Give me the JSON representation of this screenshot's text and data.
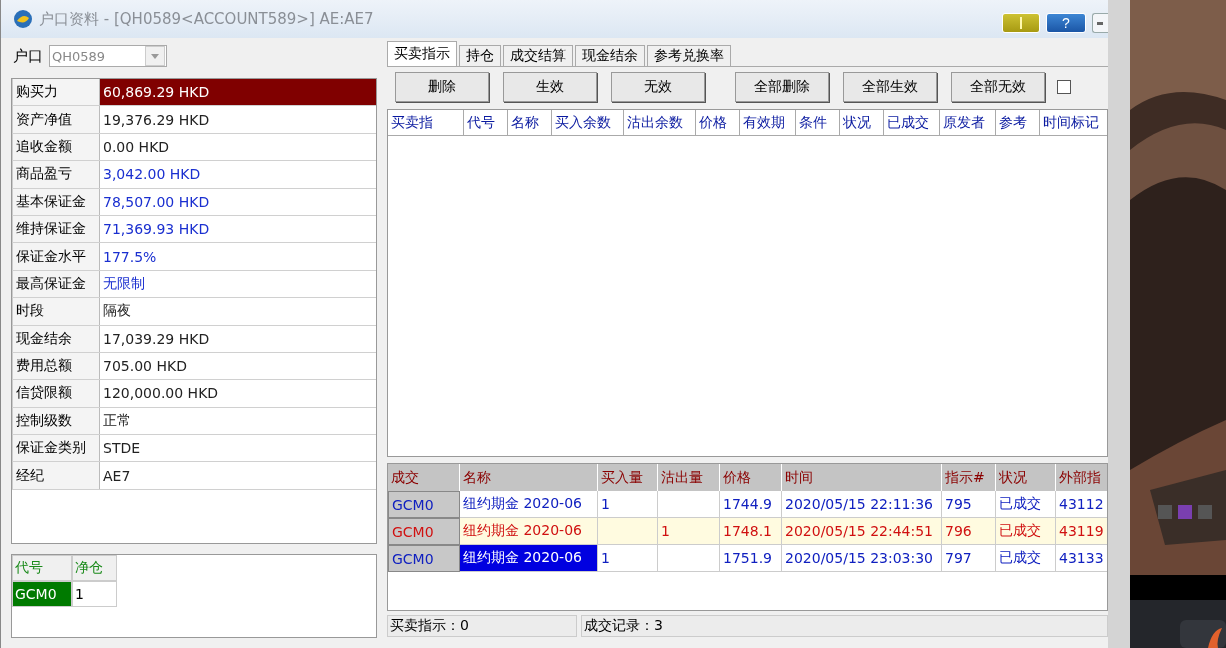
{
  "window": {
    "title": "户口资料 - [QH0589<ACCOUNT589>] AE:AE7",
    "help_label": "?"
  },
  "account": {
    "label": "户口",
    "value": "QH0589"
  },
  "summary": [
    {
      "label": "购买力",
      "value": "60,869.29 HKD",
      "kind": "alert"
    },
    {
      "label": "资产净值",
      "value": "19,376.29 HKD",
      "kind": "plain"
    },
    {
      "label": "追收金额",
      "value": "0.00 HKD",
      "kind": "plain"
    },
    {
      "label": "商品盈亏",
      "value": "3,042.00 HKD",
      "kind": "info"
    },
    {
      "label": "基本保证金",
      "value": "78,507.00 HKD",
      "kind": "info"
    },
    {
      "label": "维持保证金",
      "value": "71,369.93 HKD",
      "kind": "info"
    },
    {
      "label": "保证金水平",
      "value": "177.5%",
      "kind": "info"
    },
    {
      "label": "最高保证金",
      "value": "无限制",
      "kind": "info"
    },
    {
      "label": "时段",
      "value": "隔夜",
      "kind": "plain"
    },
    {
      "label": "现金结余",
      "value": "17,039.29 HKD",
      "kind": "plain"
    },
    {
      "label": "费用总额",
      "value": "705.00 HKD",
      "kind": "plain"
    },
    {
      "label": "信贷限额",
      "value": "120,000.00 HKD",
      "kind": "plain"
    },
    {
      "label": "控制级数",
      "value": "正常",
      "kind": "plain"
    },
    {
      "label": "保证金类别",
      "value": "STDE",
      "kind": "plain"
    },
    {
      "label": "经纪",
      "value": "AE7",
      "kind": "plain"
    }
  ],
  "positions": {
    "columns": [
      "代号",
      "净仓"
    ],
    "rows": [
      {
        "code": "GCM0",
        "net": "1"
      }
    ]
  },
  "tabs": [
    {
      "label": "买卖指示",
      "selected": true
    },
    {
      "label": "持仓",
      "selected": false
    },
    {
      "label": "成交结算",
      "selected": false
    },
    {
      "label": "现金结余",
      "selected": false
    },
    {
      "label": "参考兑换率",
      "selected": false
    }
  ],
  "buttons": [
    "删除",
    "生效",
    "无效",
    "全部删除",
    "全部生效",
    "全部无效"
  ],
  "show_checkbox": {
    "checked": false
  },
  "orders": {
    "columns": [
      "买卖指",
      "代号",
      "名称",
      "买入余数",
      "沽出余数",
      "价格",
      "有效期",
      "条件",
      "状况",
      "已成交",
      "原发者",
      "参考",
      "时间标记"
    ]
  },
  "trades": {
    "columns": [
      "成交",
      "名称",
      "买入量",
      "沽出量",
      "价格",
      "时间",
      "指示#",
      "状况",
      "外部指"
    ],
    "rows": [
      {
        "code": "GCM0",
        "name": "纽约期金 2020-06",
        "buy": "1",
        "sell": "",
        "price": "1744.9",
        "time": "2020/05/15 22:11:36",
        "order": "795",
        "status": "已成交",
        "ext": "43112",
        "kind": "buy",
        "selected": false
      },
      {
        "code": "GCM0",
        "name": "纽约期金 2020-06",
        "buy": "",
        "sell": "1",
        "price": "1748.1",
        "time": "2020/05/15 22:44:51",
        "order": "796",
        "status": "已成交",
        "ext": "43119",
        "kind": "sell",
        "selected": false
      },
      {
        "code": "GCM0",
        "name": "纽约期金 2020-06",
        "buy": "1",
        "sell": "",
        "price": "1751.9",
        "time": "2020/05/15 23:03:30",
        "order": "797",
        "status": "已成交",
        "ext": "43133",
        "kind": "buy",
        "selected": true
      }
    ]
  },
  "status_bar": [
    "买卖指示：0",
    "成交记录：3"
  ],
  "video": {
    "kind": "picture"
  }
}
